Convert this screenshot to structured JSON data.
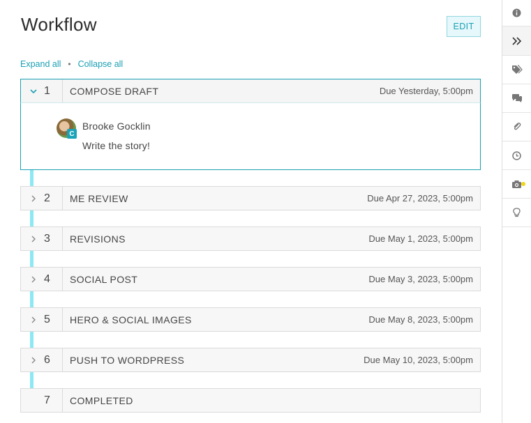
{
  "header": {
    "title": "Workflow",
    "edit_label": "EDIT"
  },
  "links": {
    "expand_all": "Expand all",
    "separator": "•",
    "collapse_all": "Collapse all"
  },
  "steps": [
    {
      "number": "1",
      "name": "COMPOSE DRAFT",
      "due": "Due Yesterday, 5:00pm",
      "expanded": true,
      "assignee": "Brooke Gocklin",
      "assignee_badge": "C",
      "note": "Write the story!"
    },
    {
      "number": "2",
      "name": "ME REVIEW",
      "due": "Due Apr 27, 2023, 5:00pm",
      "expanded": false
    },
    {
      "number": "3",
      "name": "REVISIONS",
      "due": "Due May 1, 2023, 5:00pm",
      "expanded": false
    },
    {
      "number": "4",
      "name": "SOCIAL POST",
      "due": "Due May 3, 2023, 5:00pm",
      "expanded": false
    },
    {
      "number": "5",
      "name": "HERO & SOCIAL IMAGES",
      "due": "Due May 8, 2023, 5:00pm",
      "expanded": false
    },
    {
      "number": "6",
      "name": "PUSH TO WORDPRESS",
      "due": "Due May 10, 2023, 5:00pm",
      "expanded": false
    },
    {
      "number": "7",
      "name": "COMPLETED",
      "due": "",
      "expanded": false
    }
  ],
  "rail": {
    "icons": [
      "info-icon",
      "double-chevron-right-icon",
      "tags-icon",
      "comments-icon",
      "paperclip-icon",
      "clock-icon",
      "camera-icon",
      "lightbulb-icon"
    ]
  },
  "colors": {
    "accent": "#1a9fb3",
    "timeline": "#8ee8f3",
    "badge_dot": "#f2d61a"
  }
}
